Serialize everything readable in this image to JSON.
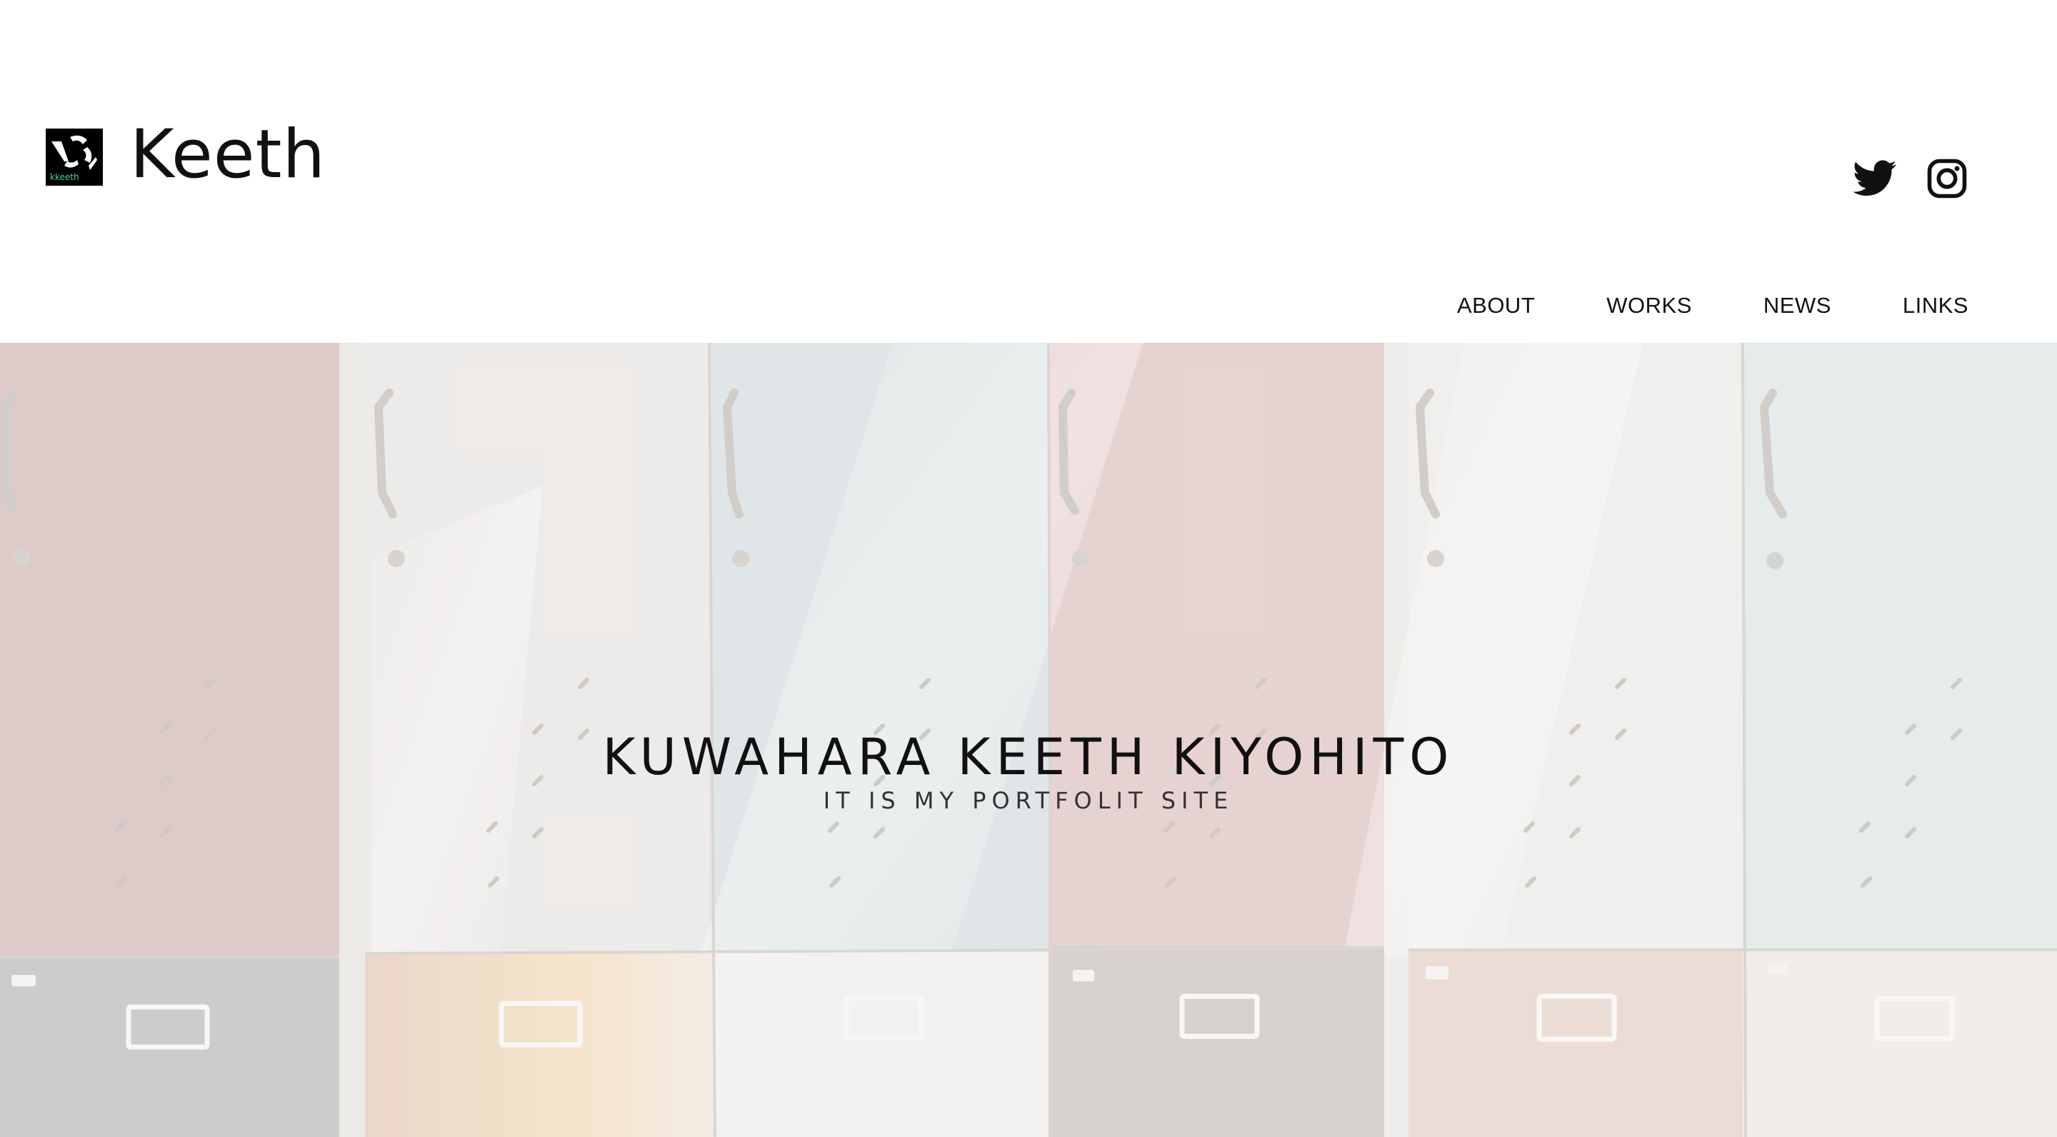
{
  "site": {
    "brand_name": "Keeth",
    "logo_icon": "keeth-logo-icon",
    "logo_text": "kkeeth"
  },
  "social": {
    "twitter_icon": "twitter-icon",
    "instagram_icon": "instagram-icon"
  },
  "nav": {
    "items": [
      {
        "label": "ABOUT"
      },
      {
        "label": "WORKS"
      },
      {
        "label": "NEWS"
      },
      {
        "label": "LINKS"
      }
    ]
  },
  "hero": {
    "title": "KUWAHARA KEETH KIYOHITO",
    "subtitle": "IT IS MY PORTFOLIT SITE",
    "background_image": "colorful-lockers-photo"
  },
  "colors": {
    "text": "#111111",
    "background": "#ffffff",
    "logo_accent": "#3fd6a8"
  }
}
